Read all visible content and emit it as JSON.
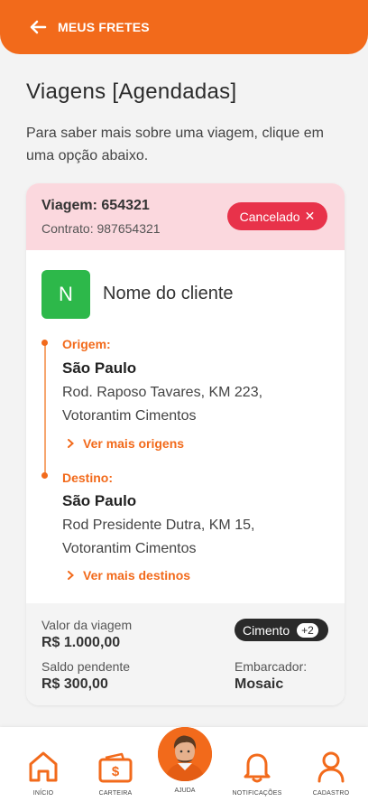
{
  "header": {
    "title": "MEUS FRETES",
    "back_icon": "arrow-left-icon"
  },
  "page": {
    "title": "Viagens [Agendadas]",
    "intro": "Para saber mais sobre uma viagem, clique em uma opção abaixo."
  },
  "trip": {
    "trip_label": "Viagem: 654321",
    "contract_label": "Contrato: 987654321",
    "status": "Cancelado",
    "status_color": "#e8324a",
    "client_initial": "N",
    "client_name": "Nome do cliente",
    "origin": {
      "label": "Origem:",
      "city": "São Paulo",
      "address_line1": "Rod. Raposo Tavares, KM 223,",
      "address_line2": "Votorantim Cimentos",
      "more": "Ver mais origens"
    },
    "destination": {
      "label": "Destino:",
      "city": "São Paulo",
      "address_line1": "Rod Presidente Dutra, KM 15,",
      "address_line2": "Votorantim Cimentos",
      "more": "Ver mais destinos"
    },
    "value_label": "Valor da viagem",
    "value": "R$ 1.000,00",
    "balance_label": "Saldo pendente",
    "balance": "R$ 300,00",
    "cargo": "Cimento",
    "cargo_extra": "+2",
    "shipper_label": "Embarcador:",
    "shipper": "Mosaic"
  },
  "tabs": [
    {
      "label": "INÍCIO",
      "icon": "home-icon"
    },
    {
      "label": "CARTEIRA",
      "icon": "wallet-icon"
    },
    {
      "label": "AJUDA",
      "icon": "avatar-help"
    },
    {
      "label": "NOTIFICAÇÕES",
      "icon": "bell-icon"
    },
    {
      "label": "CADASTRO",
      "icon": "user-icon"
    }
  ],
  "colors": {
    "accent": "#f26a1b",
    "card_header": "#fbd8de",
    "client_avatar": "#2db84a"
  }
}
